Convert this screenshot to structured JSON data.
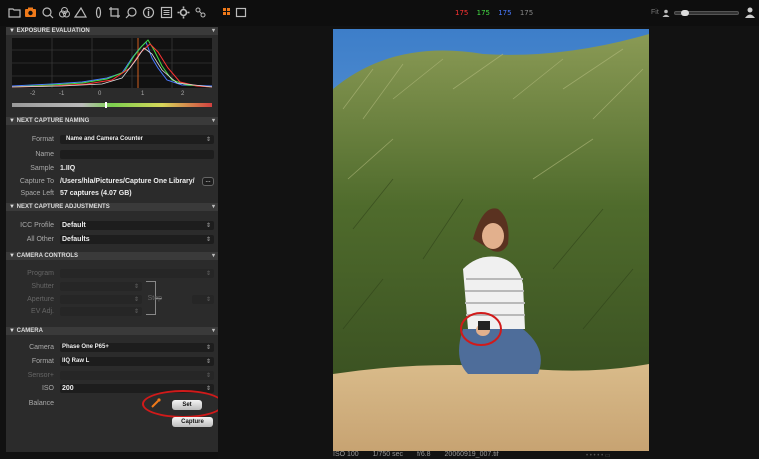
{
  "toolbar": {
    "tools": [
      {
        "name": "library-icon"
      },
      {
        "name": "capture-icon",
        "active": true
      },
      {
        "name": "quick-icon"
      },
      {
        "name": "color-icon"
      },
      {
        "name": "exposure-icon"
      },
      {
        "name": "lens-icon"
      },
      {
        "name": "crop-icon"
      },
      {
        "name": "focus-icon"
      },
      {
        "name": "metadata-icon"
      },
      {
        "name": "output-icon"
      },
      {
        "name": "settings-icon"
      },
      {
        "name": "batch-icon"
      }
    ],
    "rgb": {
      "r": "175",
      "g": "175",
      "b": "175",
      "l": "175"
    },
    "fit_label": "Fit"
  },
  "colors": {
    "accent": "#f07a1a",
    "red": "#ff3333",
    "green": "#44dd44",
    "blue": "#4a7aff",
    "annotation": "#d11a1a"
  },
  "exposure": {
    "header": "EXPOSURE EVALUATION",
    "ticks": [
      "-2",
      "-1",
      "0",
      "1",
      "2"
    ]
  },
  "naming": {
    "header": "NEXT CAPTURE NAMING",
    "format_label": "Format",
    "format_value": "Name and Camera Counter",
    "name_label": "Name",
    "name_value": "",
    "sample_label": "Sample",
    "sample_value": "1.IIQ",
    "capture_to_label": "Capture To",
    "capture_to_value": "/Users/hla/Pictures/Capture One Library/",
    "browse_label": "...",
    "space_left_label": "Space Left",
    "space_left_value": "57 captures (4.07 GB)"
  },
  "adjustments": {
    "header": "NEXT CAPTURE ADJUSTMENTS",
    "icc_label": "ICC Profile",
    "icc_value": "Default",
    "other_label": "All Other",
    "other_value": "Defaults"
  },
  "controls": {
    "header": "CAMERA CONTROLS",
    "program_label": "Program",
    "shutter_label": "Shutter",
    "aperture_label": "Aperture",
    "ev_label": "EV Adj.",
    "step_label": "Step"
  },
  "camera": {
    "header": "CAMERA",
    "camera_label": "Camera",
    "camera_value": "Phase One P65+",
    "format_label": "Format",
    "format_value": "IIQ Raw L",
    "sensor_label": "Sensor+",
    "iso_label": "ISO",
    "iso_value": "200",
    "balance_label": "Balance",
    "set_label": "Set",
    "capture_label": "Capture"
  },
  "status": {
    "iso": "ISO 100",
    "shutter": "1/750 sec",
    "aperture": "f/6.8",
    "filename": "20060919_007.tif"
  }
}
